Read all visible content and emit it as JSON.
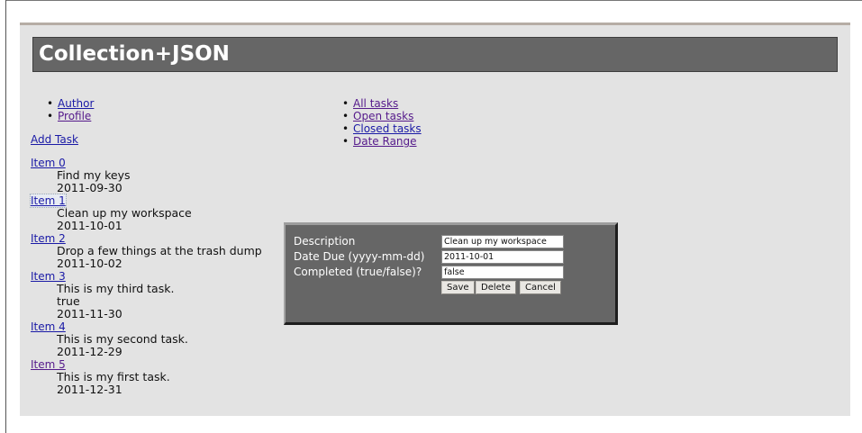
{
  "header": {
    "title": "Collection+JSON"
  },
  "nav_left": [
    {
      "label": "Author"
    },
    {
      "label": "Profile"
    }
  ],
  "nav_right": [
    {
      "label": "All tasks"
    },
    {
      "label": "Open tasks"
    },
    {
      "label": "Closed tasks"
    },
    {
      "label": "Date Range"
    }
  ],
  "add_task": {
    "label": "Add Task"
  },
  "items": [
    {
      "link": "Item 0",
      "description": "Find my keys",
      "completed": "",
      "date": "2011-09-30"
    },
    {
      "link": "Item 1",
      "description": "Clean up my workspace",
      "completed": "",
      "date": "2011-10-01"
    },
    {
      "link": "Item 2",
      "description": "Drop a few things at the trash dump",
      "completed": "",
      "date": "2011-10-02"
    },
    {
      "link": "Item 3",
      "description": "This is my third task.",
      "completed": "true",
      "date": "2011-11-30"
    },
    {
      "link": "Item 4",
      "description": "This is my second task.",
      "completed": "",
      "date": "2011-12-29"
    },
    {
      "link": "Item 5",
      "description": "This is my first task.",
      "completed": "",
      "date": "2011-12-31"
    }
  ],
  "edit_form": {
    "description_label": "Description",
    "description_value": "Clean up my workspace",
    "date_label": "Date Due (yyyy-mm-dd)",
    "date_value": "2011-10-01",
    "completed_label": "Completed (true/false)?",
    "completed_value": "false",
    "save_label": "Save",
    "delete_label": "Delete",
    "cancel_label": "Cancel"
  },
  "colors": {
    "header_bg": "#666666",
    "container_bg": "#e3e3e3",
    "link": "#1a1aa6",
    "visited_link": "#551a8b",
    "dialog_bg": "#666666"
  }
}
